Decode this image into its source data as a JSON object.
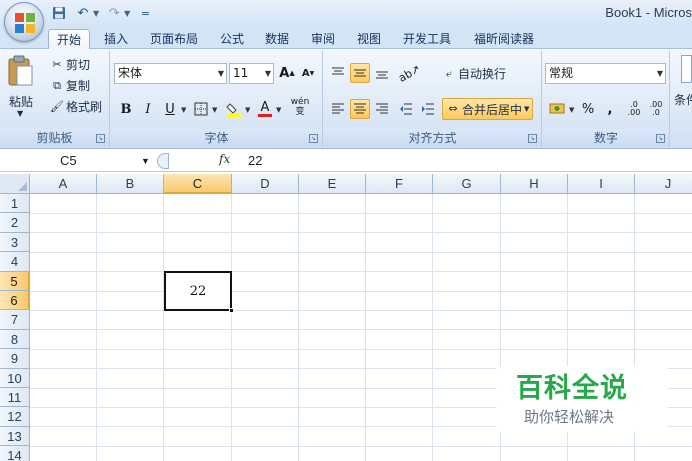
{
  "window": {
    "title": "Book1 - Micros"
  },
  "quick_access": {
    "save": "💾",
    "undo": "↶",
    "redo": "↷",
    "customize": "="
  },
  "tabs": [
    {
      "label": "开始",
      "active": true
    },
    {
      "label": "插入"
    },
    {
      "label": "页面布局"
    },
    {
      "label": "公式"
    },
    {
      "label": "数据"
    },
    {
      "label": "审阅"
    },
    {
      "label": "视图"
    },
    {
      "label": "开发工具"
    },
    {
      "label": "福昕阅读器"
    }
  ],
  "ribbon": {
    "clipboard": {
      "group_label": "剪贴板",
      "paste": "粘贴",
      "cut": "剪切",
      "copy": "复制",
      "format_painter": "格式刷"
    },
    "font": {
      "group_label": "字体",
      "font_name": "宋体",
      "font_size": "11",
      "bold": "B",
      "italic": "I",
      "underline": "U",
      "grow": "A",
      "shrink": "A",
      "font_color_letter": "A",
      "phonetic": "wén",
      "phonetic_sub": "变"
    },
    "alignment": {
      "group_label": "对齐方式",
      "wrap_text": "自动换行",
      "merge_center": "合并后居中"
    },
    "number": {
      "group_label": "数字",
      "format": "常规",
      "percent": "%",
      "comma": ",",
      "inc_decimal": ".0 .00",
      "dec_decimal": ".00 .0"
    },
    "styles": {
      "partial_label": "条件"
    }
  },
  "formula_bar": {
    "name_box": "C5",
    "fx": "fx",
    "value": "22"
  },
  "sheet": {
    "columns": [
      "A",
      "B",
      "C",
      "D",
      "E",
      "F",
      "G",
      "H",
      "I",
      "J"
    ],
    "rows": [
      "1",
      "2",
      "3",
      "4",
      "5",
      "6",
      "7",
      "8",
      "9",
      "10",
      "11",
      "12",
      "13",
      "14"
    ],
    "selected_column": "C",
    "selected_rows": [
      "5",
      "6"
    ],
    "active_cell": {
      "ref": "C5",
      "value": "22",
      "merged": "C5:C6"
    }
  },
  "watermark": {
    "title": "百科全说",
    "subtitle": "助你轻松解决"
  },
  "colors": {
    "accent": "#f9c96f",
    "ribbon": "#dce8f6",
    "watermark_green": "#27a84a"
  }
}
